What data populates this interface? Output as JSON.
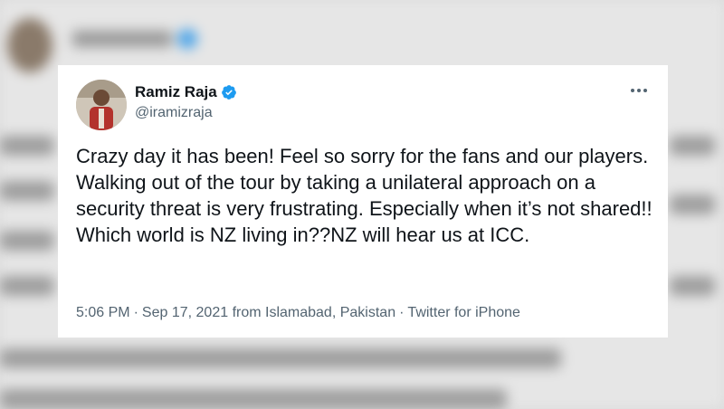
{
  "tweet": {
    "display_name": "Ramiz Raja",
    "handle": "@iramizraja",
    "text": "Crazy day it has been! Feel so  sorry for the fans and our players. Walking out of the tour by taking a unilateral approach on a security threat is very frustrating. Especially when it’s not shared!! Which world is NZ living in??NZ will hear us at ICC.",
    "time": "5:06 PM",
    "separator": "·",
    "date_location": "Sep 17, 2021 from Islamabad, Pakistan",
    "source": "Twitter for iPhone",
    "verified_color": "#1d9bf0"
  },
  "icons": {
    "verified": "verified-badge-icon",
    "more": "more-options-icon"
  }
}
